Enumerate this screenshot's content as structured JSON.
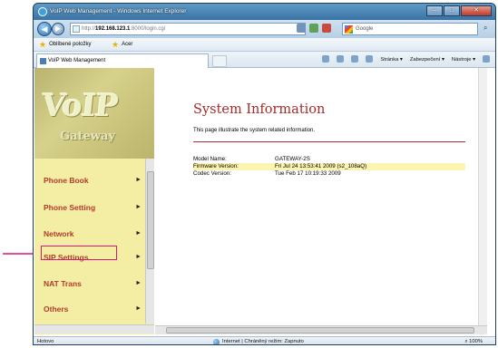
{
  "browser": {
    "window_title": "VoIP Web Management - Windows Internet Explorer",
    "url_prefix": "http://",
    "url_host": "192.168.123.1",
    "url_path": ":8000/login.cgi",
    "search_text": "Google",
    "favorites_label": "Oblíbené položky",
    "fav_link": "Acer",
    "tab_title": "VoIP Web Management",
    "commands": [
      "Stránka ▾",
      "Zabezpečení ▾",
      "Nástroje ▾"
    ],
    "status_left": "Hotovo",
    "status_zone": "Internet | Chráněný režim: Zapnuto",
    "status_zoom": "100%"
  },
  "logo": {
    "main": "VoIP",
    "sub": "Gateway"
  },
  "menu": [
    {
      "label": "Phone Book"
    },
    {
      "label": "Phone Setting"
    },
    {
      "label": "Network"
    },
    {
      "label": "SIP Settings"
    },
    {
      "label": "NAT Trans"
    },
    {
      "label": "Others"
    }
  ],
  "page": {
    "title": "System Information",
    "subtitle": "This page illustrate the system related information.",
    "rows": [
      {
        "key": "Model Name:",
        "value": "GATEWAY-2S"
      },
      {
        "key": "Firmware Version:",
        "value": "Fri Jul 24 13:53:41 2009 (s2_108aQ)"
      },
      {
        "key": "Codec Version:",
        "value": "Tue Feb 17 10:19:33 2009"
      }
    ]
  },
  "annotation": {
    "highlight_color": "#e0157a"
  }
}
